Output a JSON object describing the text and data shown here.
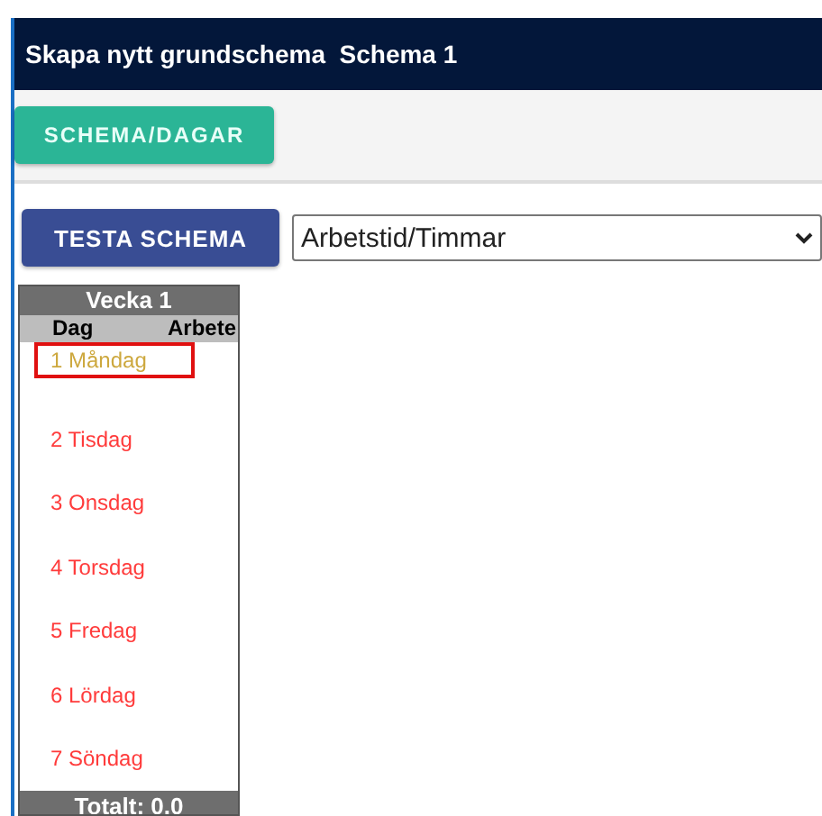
{
  "header": {
    "title": "Skapa nytt grundschema  Schema 1"
  },
  "toolbar": {
    "button": "SCHEMA/DAGAR"
  },
  "controls": {
    "button": "TESTA SCHEMA",
    "select_value": "Arbetstid/Timmar"
  },
  "week": {
    "title": "Vecka 1",
    "columns": [
      "Dag",
      "Arbete"
    ],
    "days": [
      {
        "label": "1 Måndag",
        "selected": true
      },
      {
        "label": "2 Tisdag",
        "selected": false
      },
      {
        "label": "3 Onsdag",
        "selected": false
      },
      {
        "label": "4 Torsdag",
        "selected": false
      },
      {
        "label": "5 Fredag",
        "selected": false
      },
      {
        "label": "6 Lördag",
        "selected": false
      },
      {
        "label": "7 Söndag",
        "selected": false
      }
    ],
    "total": "Totalt: 0.0"
  }
}
